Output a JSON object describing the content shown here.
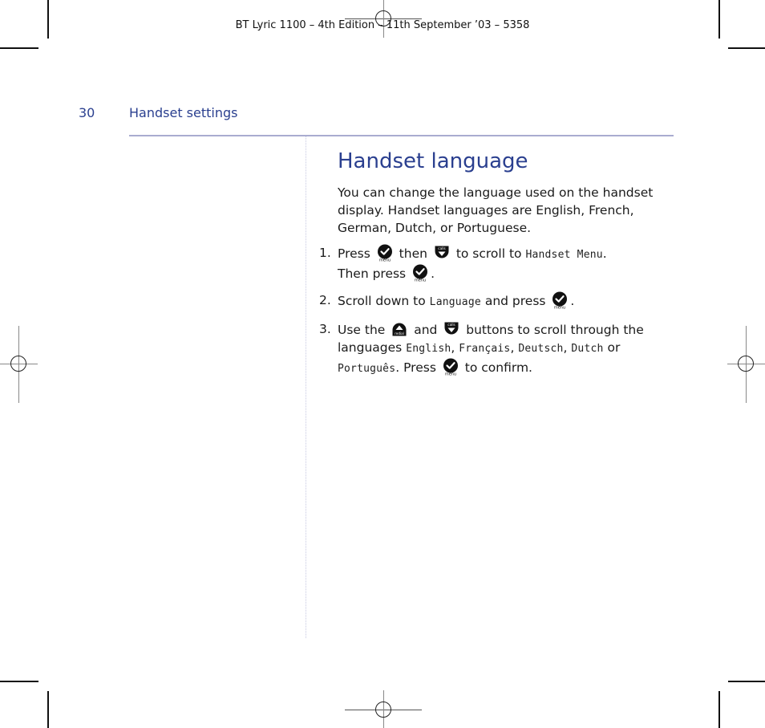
{
  "slug": "BT Lyric 1100 – 4th Edition – 11th September ’03 – 5358",
  "header": {
    "page_number": "30",
    "section": "Handset settings"
  },
  "colors": {
    "accent": "#2a3f8f",
    "rule": "#a9acd0"
  },
  "main": {
    "title": "Handset language",
    "intro": "You can change the language used on the handset display. Handset languages are English, French, German, Dutch, or Portuguese.",
    "steps": [
      {
        "number": "1.",
        "t1": "Press",
        "t2": "then",
        "t3": "to scroll to",
        "display1": "Handset Menu",
        "t4": ".",
        "t5": "Then press",
        "t6": "."
      },
      {
        "number": "2.",
        "t1": "Scroll down to",
        "display1": "Language",
        "t2": "and press",
        "t3": "."
      },
      {
        "number": "3.",
        "t1": "Use the",
        "t2": "and",
        "t3": "buttons to scroll through the languages",
        "display1": "English",
        "sep1": ",",
        "display2": "Français",
        "sep2": ",",
        "display3": "Deutsch",
        "sep3": ",",
        "display4": "Dutch",
        "t4": "or",
        "display5": "Português",
        "t5": ". Press",
        "t6": "to confirm."
      }
    ]
  },
  "icons": {
    "menu_key": "menu-ok-key-icon",
    "calls_key": "calls-down-key-icon",
    "redial_key": "redial-up-key-icon"
  }
}
